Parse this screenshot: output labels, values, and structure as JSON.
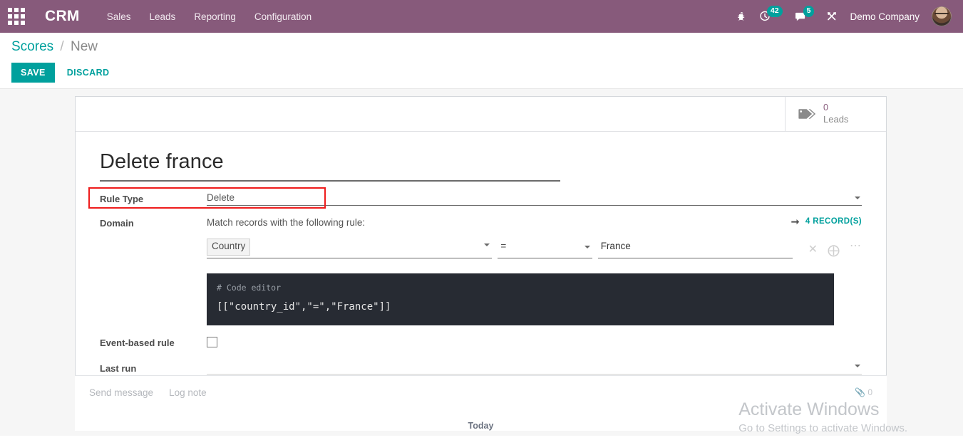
{
  "navbar": {
    "apps_icon": "apps-grid-icon",
    "brand": "CRM",
    "menu_items": [
      {
        "label": "Sales"
      },
      {
        "label": "Leads"
      },
      {
        "label": "Reporting"
      },
      {
        "label": "Configuration"
      }
    ],
    "right": {
      "bug_icon": "bug-icon",
      "activity_icon": "clock-icon",
      "activity_count": "42",
      "messages_icon": "chat-bubble-icon",
      "messages_count": "5",
      "tools_icon": "wrench-icon",
      "company": "Demo Company",
      "avatar": "user-avatar"
    },
    "accent_purple": "#875a7b",
    "badge_teal": "#00a09d"
  },
  "control_panel": {
    "breadcrumb": {
      "root": "Scores",
      "separator": "/",
      "current": "New"
    },
    "save_label": "SAVE",
    "discard_label": "DISCARD"
  },
  "button_box": {
    "leads_stat": {
      "icon": "tag-icon",
      "value": "0",
      "label": "Leads"
    }
  },
  "form": {
    "record_title": "Delete france",
    "fields": {
      "rule_type": {
        "label": "Rule Type",
        "value": "Delete"
      },
      "domain": {
        "label": "Domain",
        "intro": "Match records with the following rule:",
        "records_link": "4 RECORD(S)",
        "records_arrow_icon": "arrow-right-icon",
        "condition": {
          "field": "Country",
          "operator": "=",
          "value": "France",
          "delete_icon": "close-icon",
          "add_icon": "plus-circle-icon",
          "more_icon": "ellipsis-icon"
        },
        "code_editor": {
          "comment": "# Code editor",
          "code": "[[\"country_id\",\"=\",\"France\"]]"
        }
      },
      "event_based_rule": {
        "label": "Event-based rule",
        "checked": false
      },
      "last_run": {
        "label": "Last run",
        "value": ""
      }
    },
    "highlight_color": "#ee1c1c"
  },
  "chatter": {
    "send_message": "Send message",
    "log_note": "Log note",
    "attachment_icon": "paperclip-icon",
    "attachment_count": "0",
    "day_separator": "Today"
  },
  "watermark": {
    "title": "Activate Windows",
    "subtitle": "Go to Settings to activate Windows."
  }
}
